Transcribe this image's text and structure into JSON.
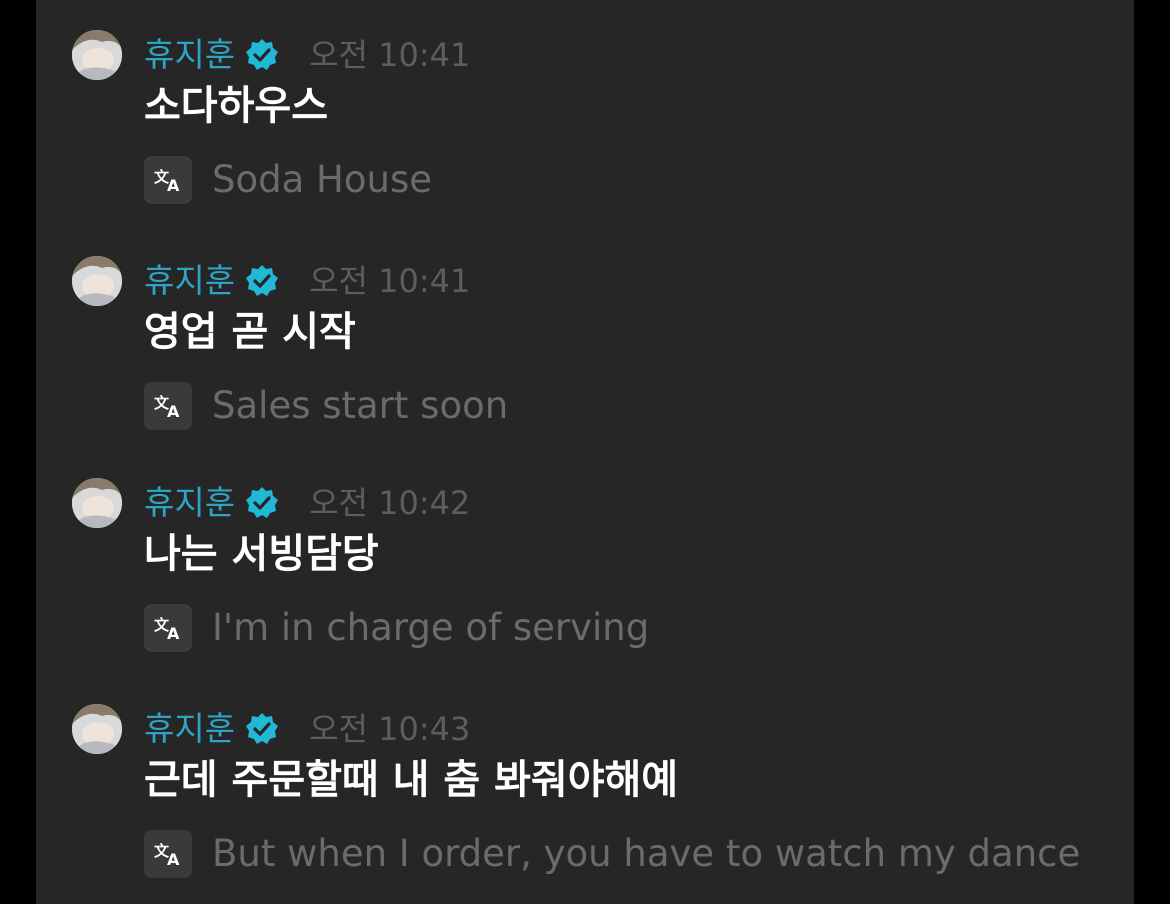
{
  "chat": {
    "messages": [
      {
        "sender": "휴지훈",
        "time": "오전 10:41",
        "text": "소다하우스",
        "translation": "Soda House"
      },
      {
        "sender": "휴지훈",
        "time": "오전 10:41",
        "text": "영업 곧 시작",
        "translation": "Sales start soon"
      },
      {
        "sender": "휴지훈",
        "time": "오전 10:42",
        "text": "나는 서빙담당",
        "translation": "I'm in charge of serving"
      },
      {
        "sender": "휴지훈",
        "time": "오전 10:43",
        "text": "근데 주문할때 내 춤 봐줘야해예",
        "translation": "But when I order, you have to watch my dance"
      }
    ],
    "icons": {
      "verified": "verified-badge-icon",
      "translate": "translate-icon",
      "avatar": "avatar"
    },
    "colors": {
      "background": "#262626",
      "sender": "#2ea3c4",
      "verified": "#20b8d6",
      "time": "#5d5d5d",
      "message_text": "#ffffff",
      "translation_text": "#6b6b6b"
    }
  }
}
